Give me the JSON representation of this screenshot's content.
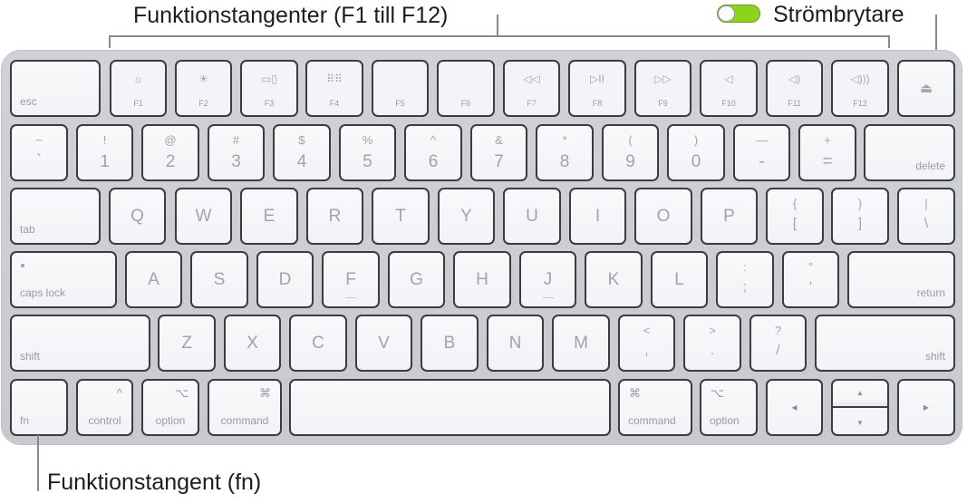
{
  "callouts": {
    "function_keys": "Funktionstangenter (F1 till F12)",
    "power_switch": "Strömbrytare",
    "fn_key": "Funktionstangent (fn)"
  },
  "power_switch": {
    "state": "on",
    "color": "#8bd31c"
  },
  "keyboard": {
    "rows": [
      [
        {
          "id": "esc",
          "label": "esc"
        },
        {
          "id": "f1",
          "fn": "F1",
          "icon": "brightness-down-icon",
          "glyph": "☼"
        },
        {
          "id": "f2",
          "fn": "F2",
          "icon": "brightness-up-icon",
          "glyph": "☀"
        },
        {
          "id": "f3",
          "fn": "F3",
          "icon": "mission-control-icon",
          "glyph": "▭▯"
        },
        {
          "id": "f4",
          "fn": "F4",
          "icon": "launchpad-icon",
          "glyph": "⠿⠿"
        },
        {
          "id": "f5",
          "fn": "F5"
        },
        {
          "id": "f6",
          "fn": "F6"
        },
        {
          "id": "f7",
          "fn": "F7",
          "icon": "rewind-icon",
          "glyph": "◁◁"
        },
        {
          "id": "f8",
          "fn": "F8",
          "icon": "play-pause-icon",
          "glyph": "▷II"
        },
        {
          "id": "f9",
          "fn": "F9",
          "icon": "fast-forward-icon",
          "glyph": "▷▷"
        },
        {
          "id": "f10",
          "fn": "F10",
          "icon": "mute-icon",
          "glyph": "◁"
        },
        {
          "id": "f11",
          "fn": "F11",
          "icon": "volume-down-icon",
          "glyph": "◁)"
        },
        {
          "id": "f12",
          "fn": "F12",
          "icon": "volume-up-icon",
          "glyph": "◁)))"
        },
        {
          "id": "eject",
          "icon": "eject-icon",
          "glyph": "⏏"
        }
      ],
      [
        {
          "id": "tilde",
          "top": "~",
          "bottom": "`"
        },
        {
          "id": "1",
          "top": "!",
          "bottom": "1"
        },
        {
          "id": "2",
          "top": "@",
          "bottom": "2"
        },
        {
          "id": "3",
          "top": "#",
          "bottom": "3"
        },
        {
          "id": "4",
          "top": "$",
          "bottom": "4"
        },
        {
          "id": "5",
          "top": "%",
          "bottom": "5"
        },
        {
          "id": "6",
          "top": "^",
          "bottom": "6"
        },
        {
          "id": "7",
          "top": "&",
          "bottom": "7"
        },
        {
          "id": "8",
          "top": "*",
          "bottom": "8"
        },
        {
          "id": "9",
          "top": "(",
          "bottom": "9"
        },
        {
          "id": "0",
          "top": ")",
          "bottom": "0"
        },
        {
          "id": "minus",
          "top": "—",
          "bottom": "-"
        },
        {
          "id": "equals",
          "top": "+",
          "bottom": "="
        },
        {
          "id": "delete",
          "label": "delete"
        }
      ],
      [
        {
          "id": "tab",
          "label": "tab"
        },
        {
          "id": "q",
          "main": "Q"
        },
        {
          "id": "w",
          "main": "W"
        },
        {
          "id": "e",
          "main": "E"
        },
        {
          "id": "r",
          "main": "R"
        },
        {
          "id": "t",
          "main": "T"
        },
        {
          "id": "y",
          "main": "Y"
        },
        {
          "id": "u",
          "main": "U"
        },
        {
          "id": "i",
          "main": "I"
        },
        {
          "id": "o",
          "main": "O"
        },
        {
          "id": "p",
          "main": "P"
        },
        {
          "id": "lbracket",
          "top": "{",
          "bottom": "["
        },
        {
          "id": "rbracket",
          "top": "}",
          "bottom": "]"
        },
        {
          "id": "backslash",
          "top": "|",
          "bottom": "\\"
        }
      ],
      [
        {
          "id": "capslock",
          "label": "caps lock"
        },
        {
          "id": "a",
          "main": "A"
        },
        {
          "id": "s",
          "main": "S"
        },
        {
          "id": "d",
          "main": "D"
        },
        {
          "id": "f",
          "main": "F"
        },
        {
          "id": "g",
          "main": "G"
        },
        {
          "id": "h",
          "main": "H"
        },
        {
          "id": "j",
          "main": "J"
        },
        {
          "id": "k",
          "main": "K"
        },
        {
          "id": "l",
          "main": "L"
        },
        {
          "id": "semicolon",
          "top": ":",
          "bottom": ";"
        },
        {
          "id": "quote",
          "top": "\"",
          "bottom": "'"
        },
        {
          "id": "return",
          "label": "return"
        }
      ],
      [
        {
          "id": "shift-left",
          "label": "shift"
        },
        {
          "id": "z",
          "main": "Z"
        },
        {
          "id": "x",
          "main": "X"
        },
        {
          "id": "c",
          "main": "C"
        },
        {
          "id": "v",
          "main": "V"
        },
        {
          "id": "b",
          "main": "B"
        },
        {
          "id": "n",
          "main": "N"
        },
        {
          "id": "m",
          "main": "M"
        },
        {
          "id": "comma",
          "top": "<",
          "bottom": ","
        },
        {
          "id": "period",
          "top": ">",
          "bottom": "."
        },
        {
          "id": "slash",
          "top": "?",
          "bottom": "/"
        },
        {
          "id": "shift-right",
          "label": "shift"
        }
      ],
      [
        {
          "id": "fn",
          "label": "fn"
        },
        {
          "id": "control-left",
          "label": "control",
          "sym": "^"
        },
        {
          "id": "option-left",
          "label": "option",
          "sym": "⌥"
        },
        {
          "id": "command-left",
          "label": "command",
          "sym": "⌘"
        },
        {
          "id": "space"
        },
        {
          "id": "command-right",
          "label": "command",
          "sym": "⌘"
        },
        {
          "id": "option-right",
          "label": "option",
          "sym": "⌥"
        },
        {
          "id": "arrow-left",
          "arrow": "◀"
        },
        {
          "id": "arrow-updown",
          "up": "▲",
          "down": "▼"
        },
        {
          "id": "arrow-right",
          "arrow": "▶"
        }
      ]
    ]
  }
}
